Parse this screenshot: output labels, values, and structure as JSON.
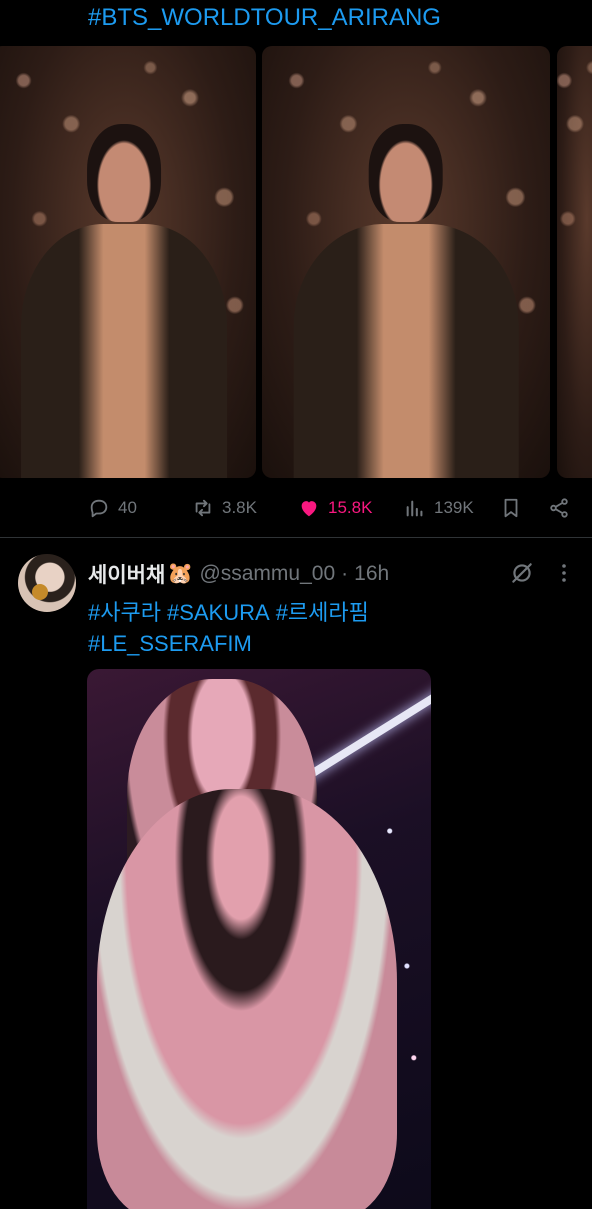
{
  "previous_tweet": {
    "hashtag": "#BTS_WORLDTOUR_ARIRANG",
    "actions": {
      "replies": "40",
      "reposts": "3.8K",
      "likes": "15.8K",
      "views": "139K"
    },
    "like_color": "#f91880"
  },
  "tweet": {
    "display_name": "세이버채",
    "name_emoji": "🐹",
    "handle": "@ssammu_00",
    "separator": "·",
    "time": "16h",
    "hashtags": [
      "#사쿠라",
      "#SAKURA",
      "#르세라핌",
      "#LE_SSERAFIM"
    ]
  },
  "colors": {
    "background": "#000000",
    "text": "#e7e9ea",
    "secondary": "#71767b",
    "link": "#1d9bf0"
  },
  "icons": [
    "reply-icon",
    "repost-icon",
    "heart-icon",
    "views-icon",
    "bookmark-icon",
    "share-icon",
    "grok-icon",
    "more-icon"
  ]
}
